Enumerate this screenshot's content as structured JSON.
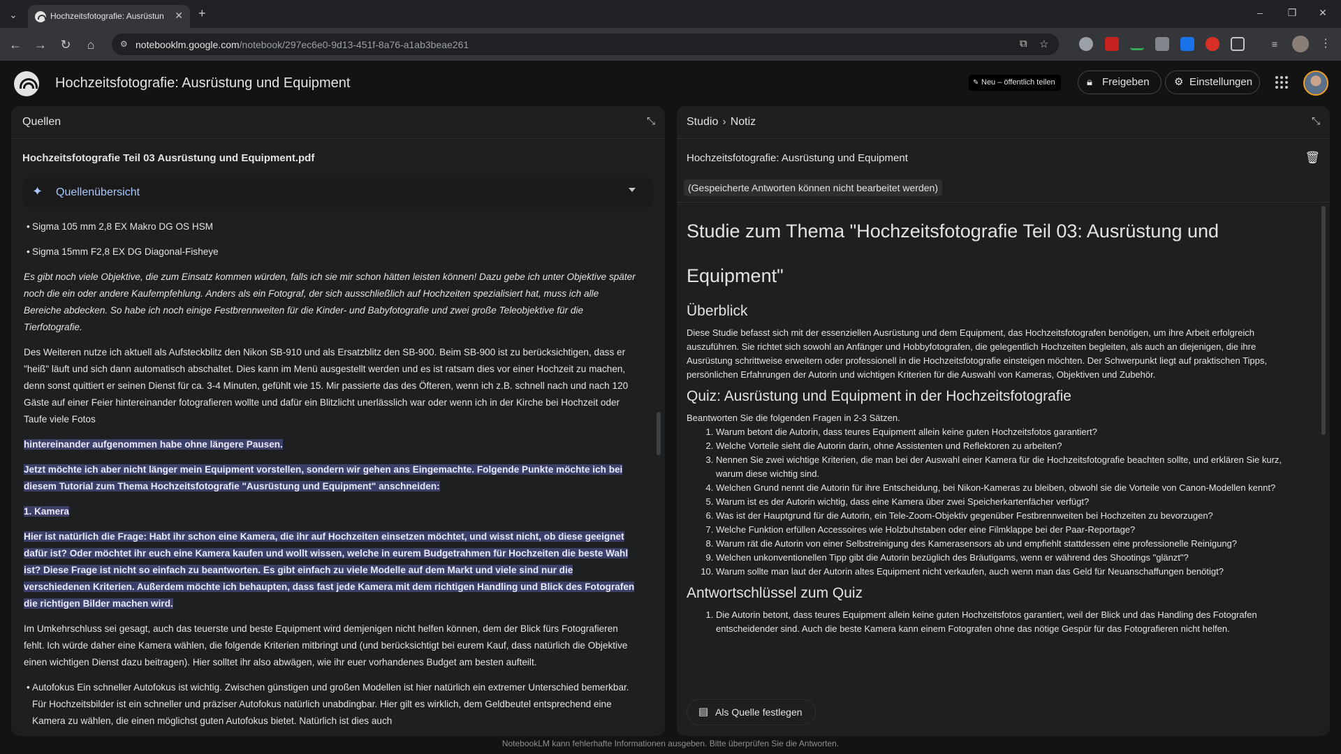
{
  "browser": {
    "tab_title": "Hochzeitsfotografie: Ausrüstun",
    "url_host": "notebooklm.google.com",
    "url_path": "/notebook/297ec6e0-9d13-451f-8a76-a1ab3beae261"
  },
  "header": {
    "title": "Hochzeitsfotografie: Ausrüstung und Equipment",
    "new_share_label": "Neu – öffentlich teilen",
    "share_label": "Freigeben",
    "settings_label": "Einstellungen"
  },
  "sources": {
    "panel_title": "Quellen",
    "filename": "Hochzeitsfotografie Teil 03 Ausrüstung und Equipment.pdf",
    "overview_label": "Quellenübersicht",
    "bullet1": "Sigma 105 mm 2,8 EX Makro DG OS HSM",
    "bullet2": "Sigma 15mm F2,8 EX DG Diagonal-Fisheye",
    "para_italic": "Es gibt noch viele Objektive, die zum Einsatz kommen würden, falls ich sie mir schon hätten leisten können! Dazu gebe ich unter Objektive später noch die ein oder andere Kaufempfehlung. Anders als ein Fotograf, der sich ausschließlich auf Hochzeiten spezialisiert hat, muss ich alle Bereiche abdecken. So habe ich noch einige Festbrennweiten für die Kinder- und Babyfotografie und zwei große Teleobjektive für die Tierfotografie.",
    "para_flash": "Des Weiteren nutze ich aktuell als Aufsteckblitz den Nikon SB-910 und als Ersatzblitz den SB-900. Beim SB-900 ist zu berücksichtigen, dass er \"heiß\" läuft und sich dann automatisch abschaltet. Dies kann im Menü ausgestellt werden und es ist ratsam dies vor einer Hochzeit zu machen, denn sonst quittiert er seinen Dienst für ca. 3-4 Minuten, gefühlt wie 15. Mir passierte das des Öfteren, wenn ich z.B. schnell nach und nach 120 Gäste auf einer Feier hintereinander fotografieren wollte und dafür ein Blitzlicht unerlässlich war oder wenn ich in der Kirche bei Hochzeit oder Taufe viele Fotos",
    "hl1": "hintereinander aufgenommen habe ohne längere Pausen.",
    "hl2": "Jetzt möchte ich aber nicht länger mein Equipment vorstellen, sondern wir gehen ans Eingemachte. Folgende Punkte möchte ich bei diesem Tutorial zum Thema Hochzeitsfotografie \"Ausrüstung und Equipment\" anschneiden:",
    "hl3": "1. Kamera",
    "hl4": "Hier ist natürlich die Frage: Habt ihr schon eine Kamera, die ihr auf Hochzeiten einsetzen möchtet, und wisst nicht, ob diese geeignet dafür ist? Oder möchtet ihr euch eine Kamera kaufen und wollt wissen, welche in eurem Budgetrahmen für Hochzeiten die beste Wahl ist? Diese Frage ist nicht so einfach zu beantworten. Es gibt einfach zu viele Modelle auf dem Markt und viele sind nur die verschiedenen Kriterien. Außerdem möchte ich behaupten, dass fast jede Kamera mit dem richtigen Handling und Blick des Fotografen die richtigen Bilder machen wird.",
    "para_umkehr": "Im Umkehrschluss sei gesagt, auch das teuerste und beste Equipment wird demjenigen nicht helfen können, dem der Blick fürs Fotografieren fehlt. Ich würde daher eine Kamera wählen, die folgende Kriterien mitbringt und (und berücksichtigt bei eurem Kauf, dass natürlich die Objektive einen wichtigen Dienst dazu beitragen). Hier solltet ihr also abwägen, wie ihr euer vorhandenes Budget am besten aufteilt.",
    "bullet_af": "Autofokus Ein schneller Autofokus ist wichtig. Zwischen günstigen und großen Modellen ist hier natürlich ein extremer Unterschied bemerkbar. Für Hochzeitsbilder ist ein schneller und präziser Autofokus natürlich unabdingbar. Hier gilt es wirklich, dem Geldbeutel entsprechend eine Kamera zu wählen, die einen möglichst guten Autofokus bietet. Natürlich ist dies auch"
  },
  "studio": {
    "crumb_studio": "Studio",
    "crumb_note": "Notiz",
    "note_title": "Hochzeitsfotografie: Ausrüstung und Equipment",
    "readonly_notice": "(Gespeicherte Antworten können nicht bearbeitet werden)",
    "h1": "Studie zum Thema \"Hochzeitsfotografie Teil 03: Ausrüstung und Equipment\"",
    "h_overview": "Überblick",
    "overview_text": "Diese Studie befasst sich mit der essenziellen Ausrüstung und dem Equipment, das Hochzeitsfotografen benötigen, um ihre Arbeit erfolgreich auszuführen. Sie richtet sich sowohl an Anfänger und Hobbyfotografen, die gelegentlich Hochzeiten begleiten, als auch an diejenigen, die ihre Ausrüstung schrittweise erweitern oder professionell in die Hochzeitsfotografie einsteigen möchten. Der Schwerpunkt liegt auf praktischen Tipps, persönlichen Erfahrungen der Autorin und wichtigen Kriterien für die Auswahl von Kameras, Objektiven und Zubehör.",
    "h_quiz": "Quiz: Ausrüstung und Equipment in der Hochzeitsfotografie",
    "quiz_intro": "Beantworten Sie die folgenden Fragen in 2-3 Sätzen.",
    "quiz": [
      "Warum betont die Autorin, dass teures Equipment allein keine guten Hochzeitsfotos garantiert?",
      "Welche Vorteile sieht die Autorin darin, ohne Assistenten und Reflektoren zu arbeiten?",
      "Nennen Sie zwei wichtige Kriterien, die man bei der Auswahl einer Kamera für die Hochzeitsfotografie beachten sollte, und erklären Sie kurz, warum diese wichtig sind.",
      "Welchen Grund nennt die Autorin für ihre Entscheidung, bei Nikon-Kameras zu bleiben, obwohl sie die Vorteile von Canon-Modellen kennt?",
      "Warum ist es der Autorin wichtig, dass eine Kamera über zwei Speicherkartenfächer verfügt?",
      "Was ist der Hauptgrund für die Autorin, ein Tele-Zoom-Objektiv gegenüber Festbrennweiten bei Hochzeiten zu bevorzugen?",
      "Welche Funktion erfüllen Accessoires wie Holzbuhstaben oder eine Filmklappe bei der Paar-Reportage?",
      "Warum rät die Autorin von einer Selbstreinigung des Kamerasensors ab und empfiehlt stattdessen eine professionelle Reinigung?",
      "Welchen unkonventionellen Tipp gibt die Autorin bezüglich des Bräutigams, wenn er während des Shootings \"glänzt\"?",
      "Warum sollte man laut der Autorin altes Equipment nicht verkaufen, auch wenn man das Geld für Neuanschaffungen benötigt?"
    ],
    "h_answers": "Antwortschlüssel zum Quiz",
    "answer1": "Die Autorin betont, dass teures Equipment allein keine guten Hochzeitsfotos garantiert, weil der Blick und das Handling des Fotografen entscheidender sind. Auch die beste Kamera kann einem Fotografen ohne das nötige Gespür für das Fotografieren nicht helfen.",
    "pin_label": "Als Quelle festlegen"
  },
  "footer": "NotebookLM kann fehlerhafte Informationen ausgeben. Bitte überprüfen Sie die Antworten.",
  "colors": {
    "accent": "#a8c7fa",
    "highlight": "#3c3f68",
    "panel": "#1e1f20",
    "background": "#131314"
  }
}
